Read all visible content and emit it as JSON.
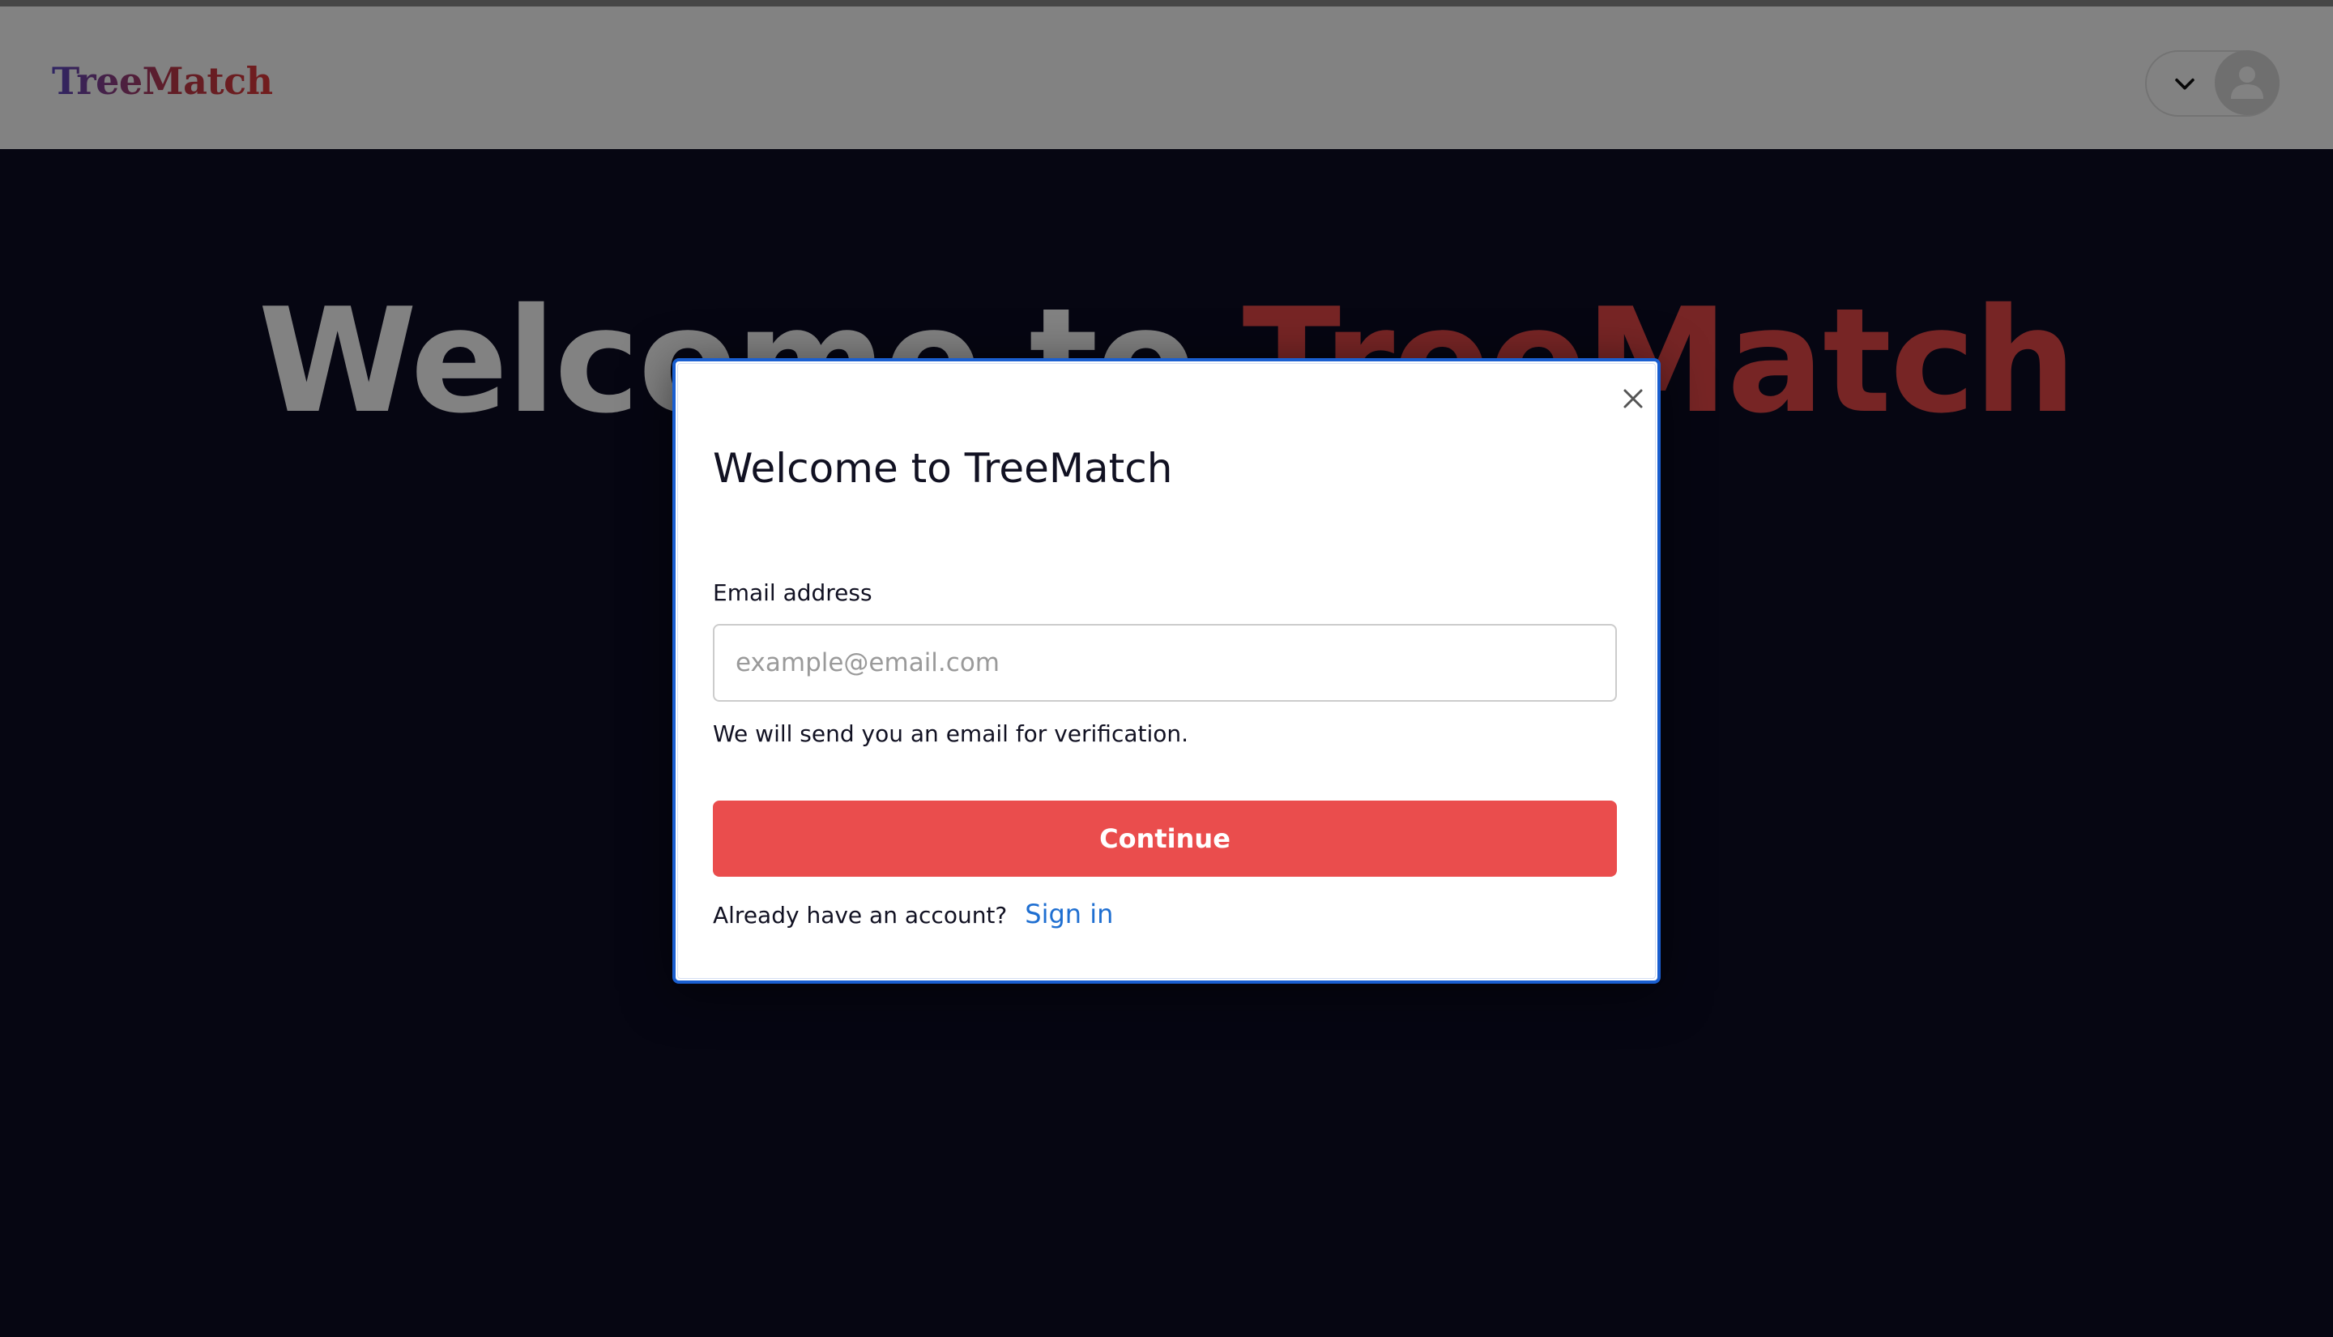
{
  "nav": {
    "brand": "TreeMatch"
  },
  "hero": {
    "title_part1": "Welcome to ",
    "title_part2": "TreeMatch"
  },
  "modal": {
    "title": "Welcome to TreeMatch",
    "email_label": "Email address",
    "email_value": "",
    "email_placeholder": "example@email.com",
    "helper_text": "We will send you an email for verification.",
    "continue_label": "Continue",
    "signin_prompt": "Already have an account?",
    "signin_link": "Sign in"
  },
  "colors": {
    "hero_background": "#0c0c24",
    "accent_red": "#ea4d4d",
    "link_blue": "#1f6fd1",
    "modal_focus_border": "#1a5fd0"
  },
  "icons": {
    "close": "close-icon",
    "chevron": "chevron-down-icon",
    "avatar": "user-avatar-icon"
  }
}
